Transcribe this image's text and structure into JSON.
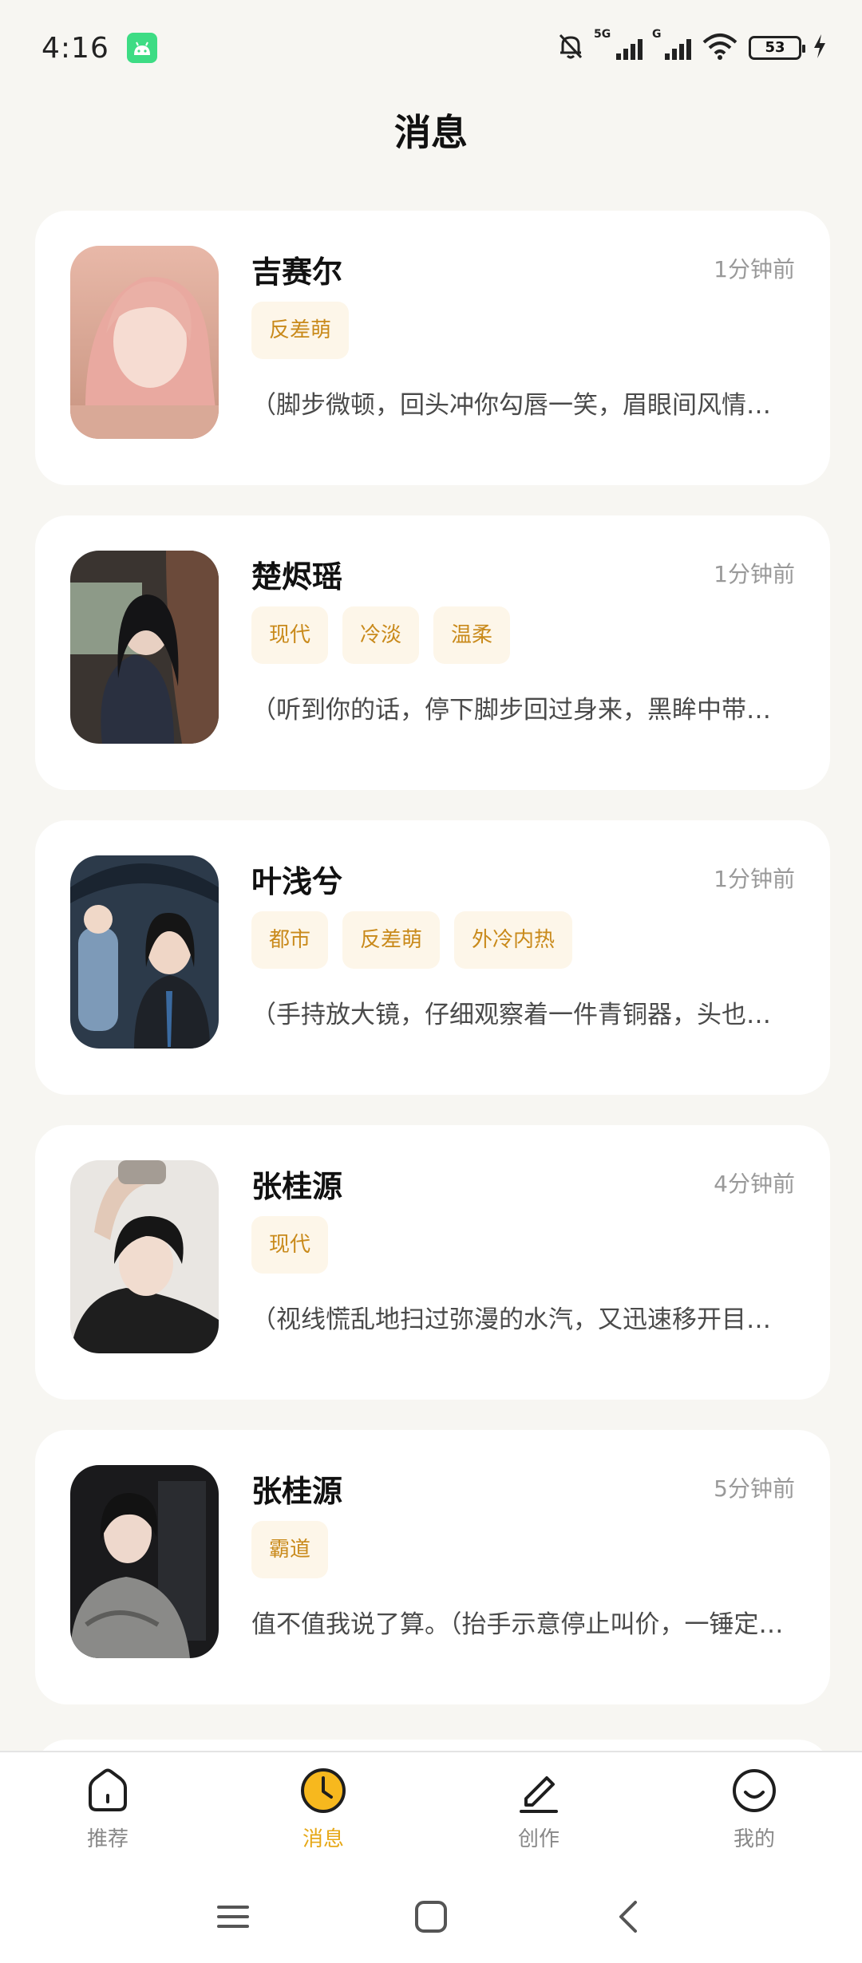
{
  "status_bar": {
    "time": "4:16",
    "network_1": "5G",
    "network_2": "G",
    "battery": "53"
  },
  "header": {
    "title": "消息"
  },
  "chats": [
    {
      "name": "吉赛尔",
      "time": "1分钟前",
      "tags": [
        "反差萌"
      ],
      "preview": "（脚步微顿，回头冲你勾唇一笑，眉眼间风情万种）",
      "avatar": "avatar-pink-hair"
    },
    {
      "name": "楚烬瑶",
      "time": "1分钟前",
      "tags": [
        "现代",
        "冷淡",
        "温柔"
      ],
      "preview": "（听到你的话，停下脚步回过身来，黑眸中带着几分疑惑）",
      "avatar": "avatar-car-seat"
    },
    {
      "name": "叶浅兮",
      "time": "1分钟前",
      "tags": [
        "都市",
        "反差萌",
        "外冷内热"
      ],
      "preview": "（手持放大镜，仔细观察着一件青铜器，头也不抬）",
      "avatar": "avatar-umbrella"
    },
    {
      "name": "张桂源",
      "time": "4分钟前",
      "tags": [
        "现代"
      ],
      "preview": "（视线慌乱地扫过弥漫的水汽，又迅速移开目光）",
      "avatar": "avatar-boy-hand"
    },
    {
      "name": "张桂源",
      "time": "5分钟前",
      "tags": [
        "霸道"
      ],
      "preview": "值不值我说了算。（抬手示意停止叫价，一锤定音）",
      "avatar": "avatar-boy-jacket"
    }
  ],
  "bottom_nav": [
    {
      "label": "推荐",
      "icon": "home-icon",
      "active": false
    },
    {
      "label": "消息",
      "icon": "clock-icon",
      "active": true
    },
    {
      "label": "创作",
      "icon": "edit-icon",
      "active": false
    },
    {
      "label": "我的",
      "icon": "smile-icon",
      "active": false
    }
  ],
  "colors": {
    "accent": "#e6a817",
    "tag_bg": "#fdf6e9",
    "tag_text": "#c98a1b",
    "background": "#f7f6f2"
  }
}
